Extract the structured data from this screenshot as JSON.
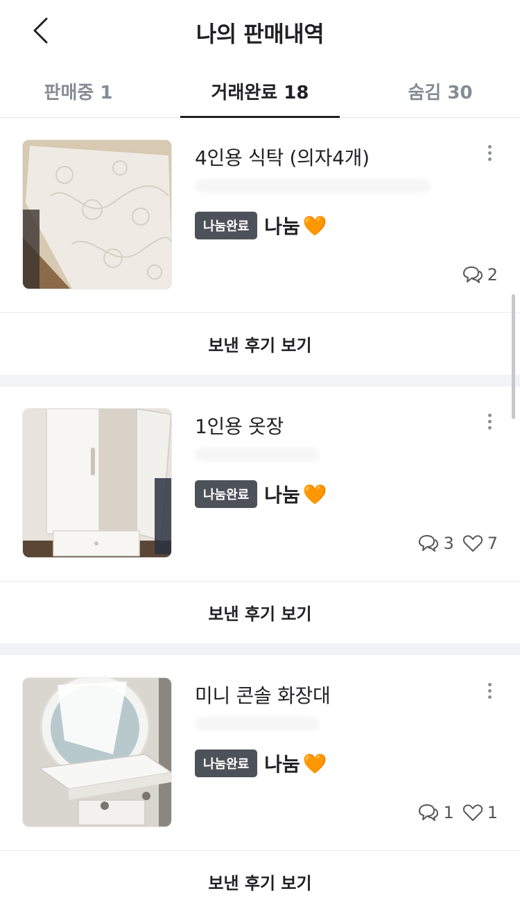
{
  "header": {
    "title": "나의 판매내역",
    "back_icon": "chevron-left-icon"
  },
  "tabs": [
    {
      "label": "판매중 1",
      "active": false
    },
    {
      "label": "거래완료 18",
      "active": true
    },
    {
      "label": "숨김 30",
      "active": false
    }
  ],
  "items": [
    {
      "title": "4인용 식탁 (의자4개)",
      "status": "나눔완료",
      "price": "나눔",
      "emoji": "🧡",
      "comments": "2",
      "likes": "",
      "review_label": "보낸 후기 보기"
    },
    {
      "title": "1인용 옷장",
      "status": "나눔완료",
      "price": "나눔",
      "emoji": "🧡",
      "comments": "3",
      "likes": "7",
      "review_label": "보낸 후기 보기"
    },
    {
      "title": "미니 콘솔 화장대",
      "status": "나눔완료",
      "price": "나눔",
      "emoji": "🧡",
      "comments": "1",
      "likes": "1",
      "review_label": "보낸 후기 보기"
    }
  ],
  "colors": {
    "badge": "#4d5159",
    "accent": "#ff8a3d",
    "divider": "#f2f3f6"
  }
}
